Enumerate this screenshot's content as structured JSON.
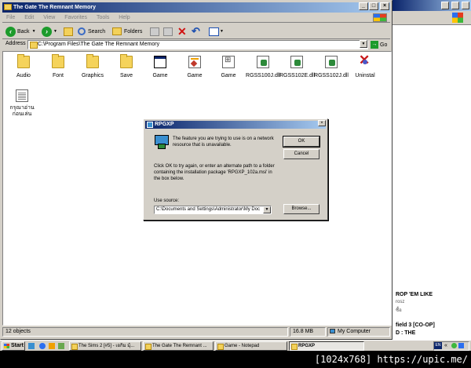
{
  "explorer": {
    "title": "The Gate The Remnant Memory",
    "menu": [
      "File",
      "Edit",
      "View",
      "Favorites",
      "Tools",
      "Help"
    ],
    "toolbar": {
      "back": "Back",
      "search": "Search",
      "folders": "Folders"
    },
    "address_label": "Address",
    "address_value": "C:\\Program Files\\The Gate The Remnant Memory",
    "go_label": "Go",
    "items": [
      {
        "label": "Audio",
        "icon": "folder-icon"
      },
      {
        "label": "Font",
        "icon": "folder-icon"
      },
      {
        "label": "Graphics",
        "icon": "folder-icon"
      },
      {
        "label": "Save",
        "icon": "folder-icon"
      },
      {
        "label": "Game",
        "icon": "application-icon"
      },
      {
        "label": "Game",
        "icon": "rgss-project-icon"
      },
      {
        "label": "Game",
        "icon": "ini-file-icon"
      },
      {
        "label": "RGSS100J.dll",
        "icon": "dll-icon"
      },
      {
        "label": "RGSS102E.dll",
        "icon": "dll-icon"
      },
      {
        "label": "RGSS102J.dll",
        "icon": "dll-icon"
      },
      {
        "label": "Uninstal",
        "icon": "uninstall-icon"
      },
      {
        "label": "กรุณาอ่านก่อนเล่น",
        "icon": "text-file-icon"
      }
    ],
    "status": {
      "objects": "12 objects",
      "size": "16.8 MB",
      "location": "My Computer"
    }
  },
  "dialog": {
    "title": "RPGXP",
    "message": "The feature you are trying to use is on a network resource that is unavailable.",
    "instructions": "Click OK to try again, or enter an alternate path to a folder containing the installation package 'RPGXP_102a.msi' in the box below.",
    "source_label": "Use source:",
    "source_value": "C:\\Documents and Settings\\Administrator\\My Doc",
    "ok": "OK",
    "cancel": "Cancel",
    "browse": "Browse..."
  },
  "background_window": {
    "line1": "ROP 'EM LIKE",
    "line2": "rosz",
    "line3": "ซื้อ",
    "line4": "field 3 [CO-OP]",
    "line5": "D : THE"
  },
  "taskbar": {
    "start": "Start",
    "tasks": [
      "The Sims 2 [#5] - เอกิม มุ้...",
      "The Gate The Remnant ...",
      "Game - Notepad",
      "RPGXP"
    ],
    "lang": "EN"
  },
  "caption": "[1024x768] https://upic.me/"
}
